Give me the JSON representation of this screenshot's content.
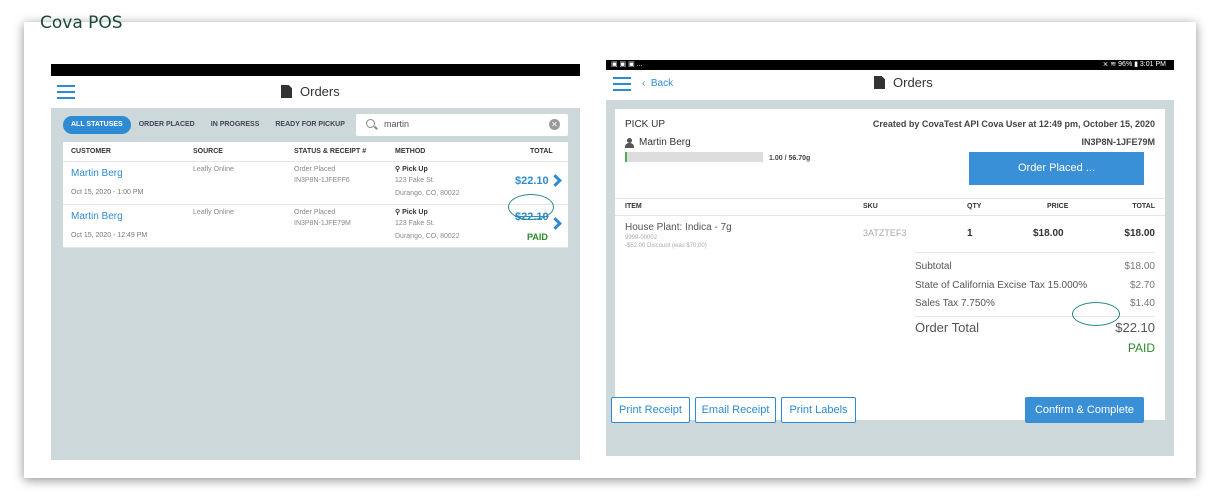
{
  "brand": "Cova POS",
  "left": {
    "title": "Orders",
    "filters": [
      "ALL STATUSES",
      "ORDER PLACED",
      "IN PROGRESS",
      "READY FOR PICKUP"
    ],
    "active_filter": "ALL STATUSES",
    "search_value": "martin",
    "columns": [
      "CUSTOMER",
      "SOURCE",
      "STATUS & RECEIPT #",
      "METHOD",
      "TOTAL"
    ],
    "rows": [
      {
        "customer": "Martin Berg",
        "date": "Oct 15, 2020 - 1:00 PM",
        "source": "Leafly Online",
        "status": "Order Placed",
        "receipt": "IN3P8N-1JFEFF6",
        "method": "Pick Up",
        "address1": "123 Fake St.",
        "address2": "Durango, CO, 80022",
        "total": "$22.10",
        "paid": ""
      },
      {
        "customer": "Martin Berg",
        "date": "Oct 15, 2020 - 12:49 PM",
        "source": "Leafly Online",
        "status": "Order Placed",
        "receipt": "IN3P8N-1JFE79M",
        "method": "Pick Up",
        "address1": "123 Fake St.",
        "address2": "Durango, CO, 80022",
        "total": "$22.10",
        "paid": "PAID"
      }
    ]
  },
  "right": {
    "status_left": "▣ ▣ ▣ ...",
    "status_right": "⨯ ≋ 96% ▮ 3:01 PM",
    "back_label": "Back",
    "title": "Orders",
    "pickup_label": "PICK UP",
    "customer": "Martin Berg",
    "created": "Created by CovaTest API Cova User at 12:49 pm, October 15, 2020",
    "receipt": "IN3P8N-1JFE79M",
    "progress_fraction": 0.018,
    "progress_text": "1.00 / 56.70g",
    "status_button": "Order Placed ...",
    "item_columns": [
      "ITEM",
      "SKU",
      "QTY",
      "PRICE",
      "TOTAL"
    ],
    "item": {
      "name": "House Plant: Indica - 7g",
      "code": "9999-00002",
      "discount": "-$52.00 Discount (was $70.00)",
      "sku": "3ATZTEF3",
      "qty": "1",
      "price": "$18.00",
      "total": "$18.00"
    },
    "subtotal_label": "Subtotal",
    "subtotal": "$18.00",
    "excise_label": "State of California Excise Tax 15.000%",
    "excise": "$2.70",
    "sales_label": "Sales Tax 7.750%",
    "sales": "$1.40",
    "order_total_label": "Order Total",
    "order_total": "$22.10",
    "paid": "PAID",
    "buttons": {
      "print_receipt": "Print Receipt",
      "email_receipt": "Email Receipt",
      "print_labels": "Print Labels",
      "confirm": "Confirm & Complete"
    }
  },
  "colors": {
    "accent": "#2e8bd3",
    "paid": "#2a8a2a",
    "panel_bg": "#cdd8da"
  }
}
